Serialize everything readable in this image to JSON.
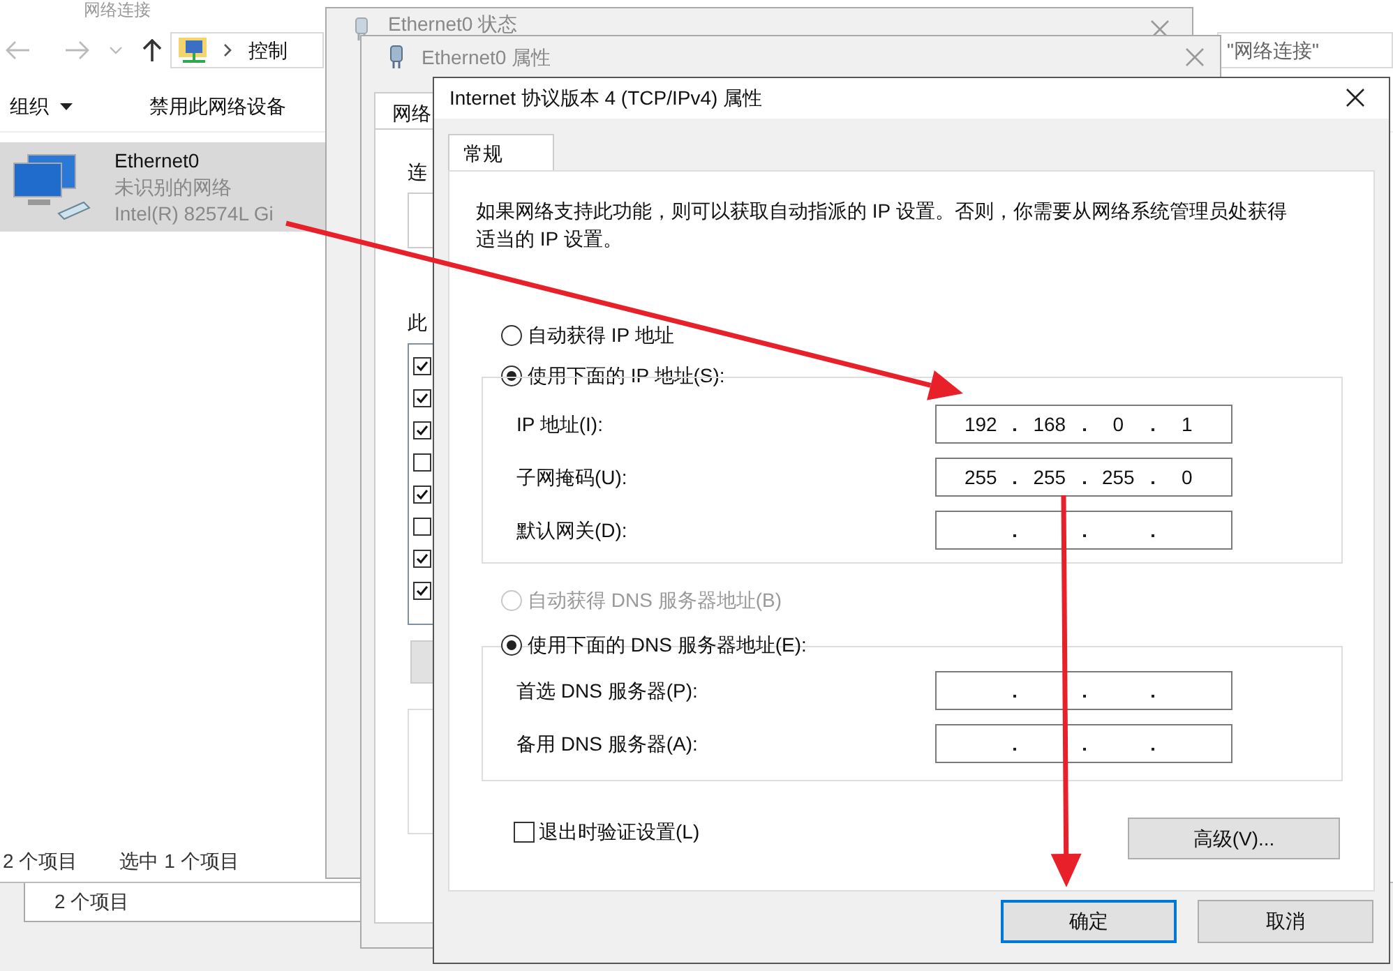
{
  "explorer": {
    "title": "网络连接",
    "address": "控制",
    "search": "\"网络连接\"",
    "toolbar": [
      {
        "label": "组织",
        "kind": "menu"
      },
      {
        "label": "禁用此网络设备",
        "kind": "action"
      }
    ],
    "adapter": {
      "name": "Ethernet0",
      "status": "未识别的网络",
      "device": "Intel(R) 82574L Gi",
      "selected": true
    },
    "status_bar": [
      "2 个项目",
      "选中 1 个项目"
    ]
  },
  "back_window": {
    "status_bar": [
      "2 个项目"
    ]
  },
  "status_window": {
    "title": "Ethernet0 状态"
  },
  "properties_window": {
    "title": "Ethernet0 属性",
    "tab": "网络",
    "labels": [
      "连",
      "此"
    ],
    "components": [
      {
        "checked": true
      },
      {
        "checked": true
      },
      {
        "checked": true
      },
      {
        "checked": false
      },
      {
        "checked": true
      },
      {
        "checked": false
      },
      {
        "checked": true
      },
      {
        "checked": true
      }
    ]
  },
  "ipv4_dialog": {
    "title": "Internet 协议版本 4 (TCP/IPv4) 属性",
    "tabs": [
      {
        "label": "常规",
        "selected": true
      }
    ],
    "description": "如果网络支持此功能，则可以获取自动指派的 IP 设置。否则，你需要从网络系统管理员处获得适当的 IP 设置。",
    "ip_mode": [
      {
        "label": "自动获得 IP 地址",
        "selected": false,
        "disabled": false
      },
      {
        "label": "使用下面的 IP 地址(S):",
        "selected": true,
        "disabled": false
      }
    ],
    "ip_fields": [
      {
        "label": "IP 地址(I):",
        "octets": [
          "192",
          "168",
          "0",
          "1"
        ]
      },
      {
        "label": "子网掩码(U):",
        "octets": [
          "255",
          "255",
          "255",
          "0"
        ]
      },
      {
        "label": "默认网关(D):"
      }
    ],
    "dns_mode": [
      {
        "label": "自动获得 DNS 服务器地址(B)",
        "selected": false,
        "disabled": true
      },
      {
        "label": "使用下面的 DNS 服务器地址(E):",
        "selected": true,
        "disabled": false
      }
    ],
    "dns_fields": [
      {
        "label": "首选 DNS 服务器(P):"
      },
      {
        "label": "备用 DNS 服务器(A):"
      }
    ],
    "validate_on_exit": {
      "label": "退出时验证设置(L)",
      "checked": false
    },
    "advanced_button": "高级(V)...",
    "buttons": [
      {
        "label": "确定",
        "default": true
      },
      {
        "label": "取消",
        "default": false
      }
    ]
  }
}
